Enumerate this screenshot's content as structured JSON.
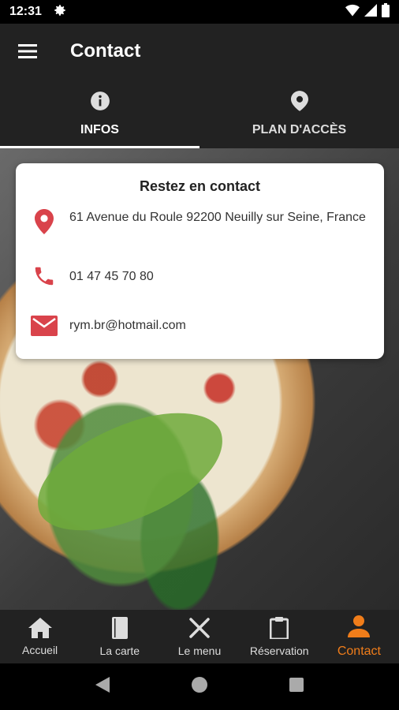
{
  "status_bar": {
    "time": "12:31"
  },
  "app_bar": {
    "title": "Contact"
  },
  "tabs": [
    {
      "label": "INFOS",
      "icon": "info-icon",
      "active": true
    },
    {
      "label": "PLAN D'ACCÈS",
      "icon": "location-pin-icon",
      "active": false
    }
  ],
  "card": {
    "title": "Restez en contact",
    "address": "61 Avenue du Roule 92200 Neuilly sur Seine, France",
    "phone": "01 47 45 70 80",
    "email": "rym.br@hotmail.com"
  },
  "bottom_nav": [
    {
      "label": "Accueil",
      "icon": "home-icon",
      "active": false
    },
    {
      "label": "La carte",
      "icon": "book-icon",
      "active": false
    },
    {
      "label": "Le menu",
      "icon": "utensils-icon",
      "active": false
    },
    {
      "label": "Réservation",
      "icon": "clipboard-icon",
      "active": false
    },
    {
      "label": "Contact",
      "icon": "person-icon",
      "active": true
    }
  ],
  "colors": {
    "accent": "#f07d1a",
    "icon_red": "#d9434b",
    "bar_bg": "#222222"
  }
}
